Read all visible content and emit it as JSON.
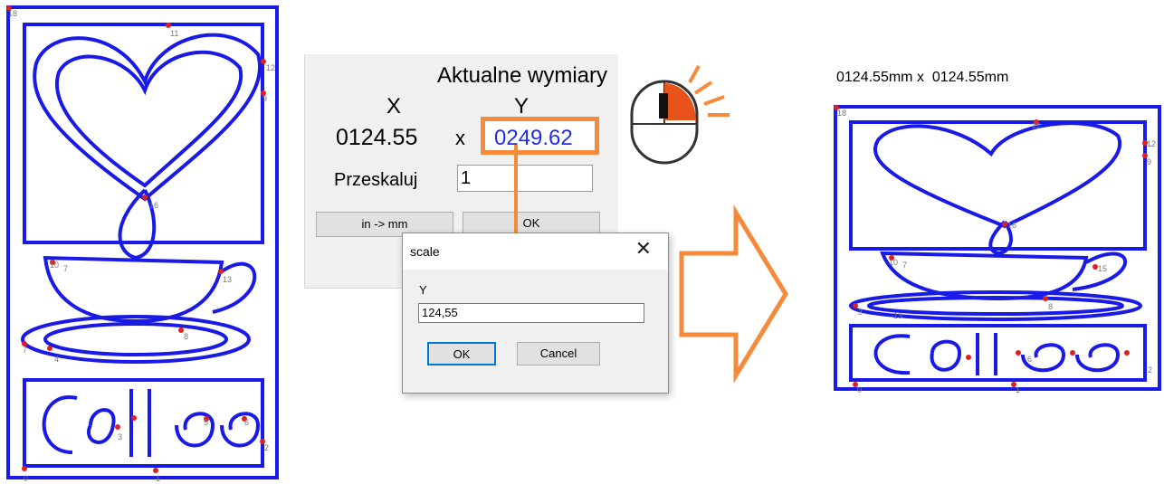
{
  "panel": {
    "title": "Aktualne wymiary",
    "x_label": "X",
    "y_label": "Y",
    "x_value": "0124.55",
    "separator": "x",
    "y_value": "0249.62",
    "scale_label": "Przeskaluj",
    "scale_value": "1",
    "in_mm_button": "in -> mm",
    "ok_button": "OK"
  },
  "dialog": {
    "title": "scale",
    "close": "✕",
    "field_label": "Y",
    "field_value": "124,55",
    "ok": "OK",
    "cancel": "Cancel"
  },
  "result": {
    "dimensions": "0124.55mm x  0124.55mm"
  },
  "left_points": [
    "18",
    "11",
    "12",
    "9",
    "16",
    "10",
    "7",
    "13",
    "8",
    "7",
    "4",
    "3",
    "5",
    "6",
    "0",
    "1",
    "2"
  ],
  "right_points": [
    "18",
    "11",
    "12",
    "9",
    "16",
    "10",
    "7",
    "15",
    "8",
    "14",
    "3",
    "5",
    "6",
    "0",
    "1",
    "2"
  ],
  "colors": {
    "art": "#1a1ae6",
    "highlight": "#f58a3a",
    "point": "#e02020"
  }
}
